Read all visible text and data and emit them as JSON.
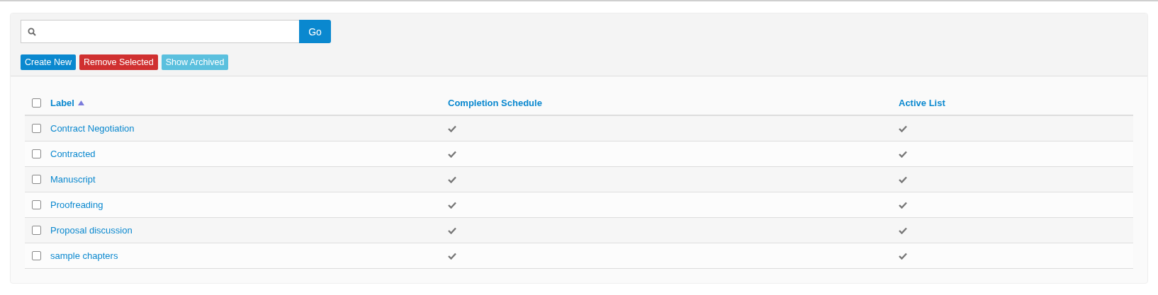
{
  "search": {
    "button": "Go"
  },
  "actions": [
    {
      "label": "Create New",
      "kind": "primary"
    },
    {
      "label": "Remove Selected",
      "kind": "danger"
    },
    {
      "label": "Show Archived",
      "kind": "info"
    }
  ],
  "table": {
    "select_all": {
      "checked": false
    },
    "columns": [
      {
        "label": "Label",
        "sorted": true
      },
      {
        "label": "Completion Schedule",
        "sorted": false
      },
      {
        "label": "Active List",
        "sorted": false
      }
    ],
    "rows": [
      {
        "label": "Contract Negotiation",
        "checked": false,
        "completion_schedule": true,
        "active_list": true
      },
      {
        "label": "Contracted",
        "checked": false,
        "completion_schedule": true,
        "active_list": true
      },
      {
        "label": "Manuscript",
        "checked": false,
        "completion_schedule": true,
        "active_list": true
      },
      {
        "label": "Proofreading",
        "checked": false,
        "completion_schedule": true,
        "active_list": true
      },
      {
        "label": "Proposal discussion",
        "checked": false,
        "completion_schedule": true,
        "active_list": true
      },
      {
        "label": "sample chapters",
        "checked": false,
        "completion_schedule": true,
        "active_list": true
      }
    ]
  }
}
